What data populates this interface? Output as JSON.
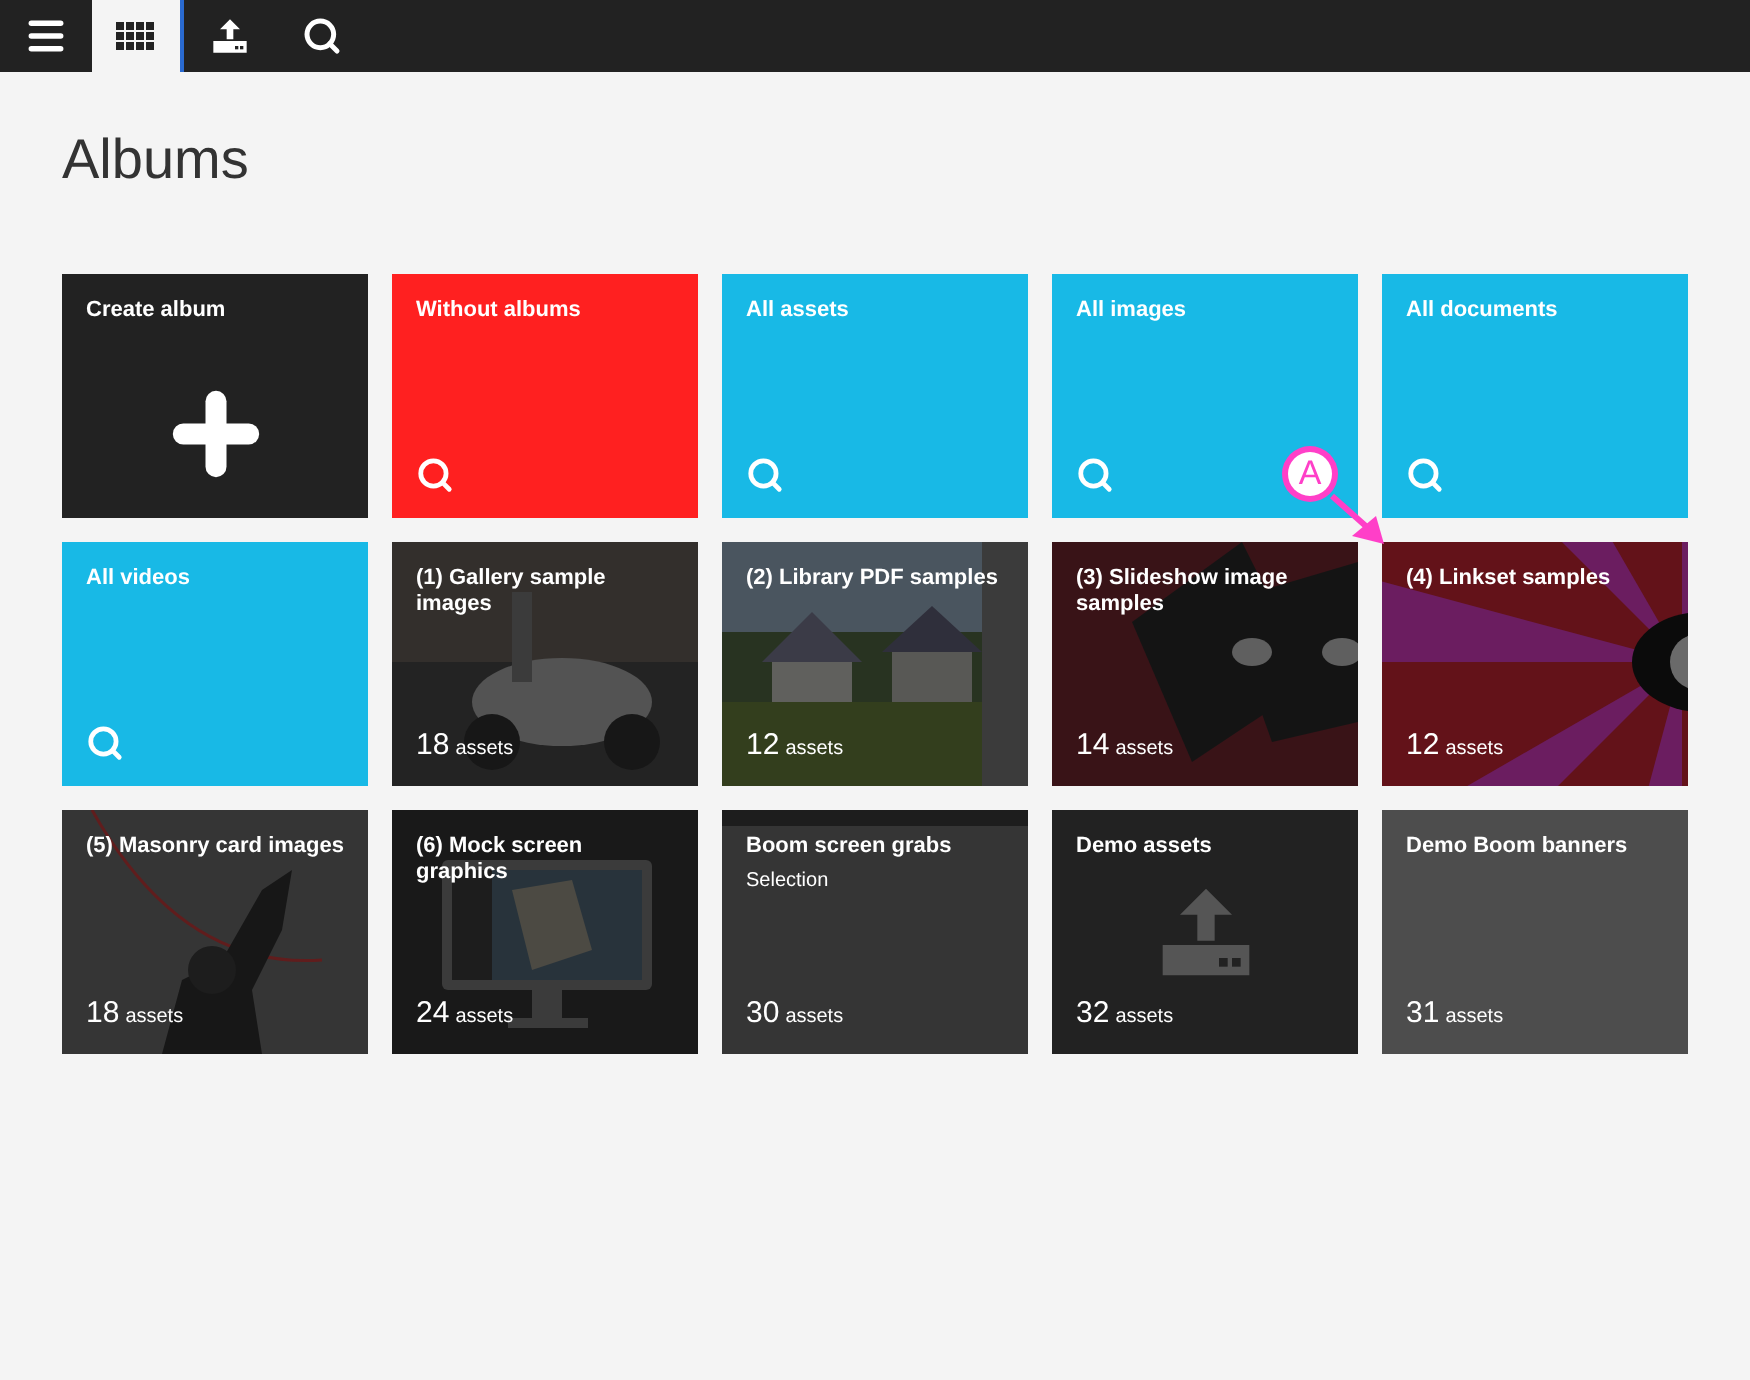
{
  "toolbar": [
    {
      "kind": "menu",
      "selected": false
    },
    {
      "kind": "grid",
      "selected": true
    },
    {
      "kind": "upload",
      "selected": false
    },
    {
      "kind": "search",
      "selected": false
    }
  ],
  "title": "Albums",
  "tiles": [
    {
      "kind": "create",
      "title": "Create album",
      "color": "#222222"
    },
    {
      "kind": "search",
      "title": "Without albums",
      "color": "#ff2020"
    },
    {
      "kind": "search",
      "title": "All assets",
      "color": "#18b9e6"
    },
    {
      "kind": "search",
      "title": "All images",
      "color": "#18b9e6"
    },
    {
      "kind": "search",
      "title": "All documents",
      "color": "#18b9e6"
    },
    {
      "kind": "search",
      "title": "All videos",
      "color": "#18b9e6"
    },
    {
      "title": "(1) Gallery sample images",
      "count": "18",
      "unit": "assets"
    },
    {
      "title": "(2) Library PDF samples",
      "count": "12",
      "unit": "assets"
    },
    {
      "title": "(3) Slideshow image samples",
      "count": "14",
      "unit": "assets"
    },
    {
      "title": "(4) Linkset samples",
      "count": "12",
      "unit": "assets"
    },
    {
      "title": "(5) Masonry card images",
      "count": "18",
      "unit": "assets"
    },
    {
      "title": "(6) Mock screen graphics",
      "count": "24",
      "unit": "assets"
    },
    {
      "title": "Boom screen grabs",
      "subtitle": "Selection",
      "count": "30",
      "unit": "assets"
    },
    {
      "kind": "upload",
      "title": "Demo assets",
      "count": "32",
      "unit": "assets"
    },
    {
      "kind": "plain",
      "title": "Demo Boom banners",
      "count": "31",
      "unit": "assets"
    }
  ],
  "annotation": {
    "label": "A"
  }
}
